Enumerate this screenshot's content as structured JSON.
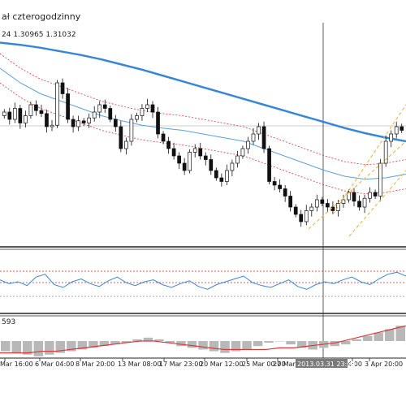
{
  "chart_data": {
    "type": "candlestick",
    "title": "ał czterogodzinny",
    "subtitle": "24 1.30965 1.31032",
    "indicator_label": "593",
    "x_tick_labels": [
      "Mar 16:00",
      "6 Mar 04:00",
      "8 Mar 20:00",
      "13 Mar 08:00",
      "17 Mar 23:00",
      "20 Mar 12:00",
      "25 Mar 00:00",
      "27 Mar",
      "2013.03.31 23:00",
      "4:00",
      "3 Apr 20:00"
    ],
    "crosshair_label": "2013.03.31 23:00",
    "colors": {
      "ma_slow": "#3a86d6",
      "ma_fast": "#5e9fd8",
      "envelope": "#d43a3a",
      "channel": "#e8b040",
      "rsi": "#3a86d6",
      "macd_signal": "#d43a3a",
      "histogram": "#b8b8b8"
    },
    "price_closes": [
      1.308,
      1.307,
      1.3085,
      1.3065,
      1.3075,
      1.309,
      1.3082,
      1.3078,
      1.306,
      1.3062,
      1.312,
      1.3105,
      1.307,
      1.306,
      1.3068,
      1.3065,
      1.3072,
      1.308,
      1.309,
      1.3085,
      1.307,
      1.306,
      1.303,
      1.304,
      1.307,
      1.3075,
      1.3085,
      1.309,
      1.308,
      1.305,
      1.304,
      1.303,
      1.302,
      1.301,
      1.3,
      1.3025,
      1.303,
      1.302,
      1.3015,
      1.3,
      1.299,
      1.2985,
      1.3,
      1.301,
      1.302,
      1.303,
      1.304,
      1.305,
      1.306,
      1.303,
      1.2985,
      1.298,
      1.2975,
      1.2965,
      1.295,
      1.294,
      1.293,
      1.2945,
      1.295,
      1.296,
      1.2955,
      1.295,
      1.2945,
      1.2955,
      1.296,
      1.297,
      1.2958,
      1.295,
      1.2962,
      1.297,
      1.2965,
      1.301,
      1.304,
      1.305,
      1.306,
      1.3055
    ],
    "ma_slow": [
      1.3175,
      1.3172,
      1.3168,
      1.3163,
      1.3158,
      1.3152,
      1.3145,
      1.3138,
      1.313,
      1.3122,
      1.3114,
      1.3106,
      1.3098,
      1.309,
      1.3082,
      1.3074,
      1.3066,
      1.3058,
      1.3051,
      1.3045,
      1.304
    ],
    "ma_fast": [
      1.314,
      1.312,
      1.3105,
      1.3095,
      1.3085,
      1.3075,
      1.3068,
      1.3062,
      1.3058,
      1.3055,
      1.305,
      1.3045,
      1.304,
      1.303,
      1.302,
      1.301,
      1.3,
      1.2992,
      1.2988,
      1.299,
      1.2995
    ],
    "rsi": [
      52,
      48,
      50,
      46,
      55,
      58,
      47,
      44,
      50,
      53,
      48,
      45,
      51,
      55,
      49,
      46,
      50,
      52,
      47,
      44,
      48,
      51,
      45,
      42,
      47,
      50,
      53,
      56,
      49,
      46,
      44,
      48,
      52,
      45,
      42,
      47,
      50,
      48,
      52,
      55,
      50,
      47,
      53,
      58,
      60,
      56
    ],
    "macd_histogram": [
      -0.0006,
      -0.0007,
      -0.0008,
      -0.0009,
      -0.0008,
      -0.0007,
      -0.0006,
      -0.0005,
      -0.0004,
      -0.0003,
      -0.0002,
      -0.0001,
      0.0001,
      0.0002,
      0.0001,
      -0.0001,
      -0.0003,
      -0.0004,
      -0.0005,
      -0.0006,
      -0.0007,
      -0.0006,
      -0.0005,
      -0.0003,
      -0.0001,
      0.0,
      -0.0002,
      -0.0004,
      -0.0005,
      -0.0004,
      -0.0003,
      -0.0002,
      0.0001,
      0.0003,
      0.0005,
      0.0007,
      0.0009
    ],
    "macd_signal": [
      -0.0007,
      -0.0007,
      -0.0007,
      -0.0006,
      -0.0006,
      -0.0005,
      -0.0004,
      -0.0003,
      -0.0002,
      -0.0001,
      0.0,
      0.0,
      -0.0001,
      -0.0002,
      -0.0003,
      -0.0004,
      -0.0005,
      -0.0005,
      -0.0005,
      -0.0005,
      -0.0004,
      -0.0004,
      -0.0003,
      -0.0002,
      -0.0001,
      0.0001,
      0.0003,
      0.0005,
      0.0007,
      0.0009
    ],
    "grid": false
  }
}
